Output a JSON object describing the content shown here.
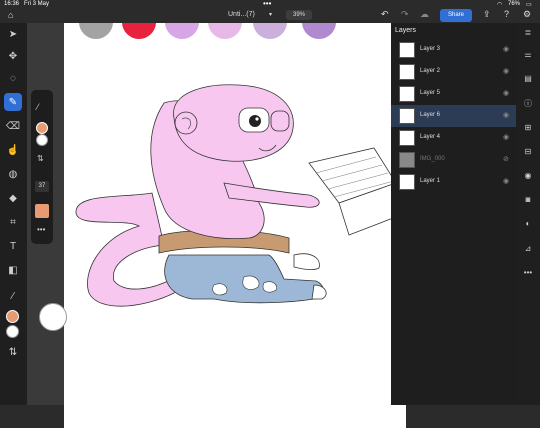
{
  "status": {
    "time": "16:36",
    "date": "Fri 3 May",
    "battery": "76%"
  },
  "document": {
    "title": "Unti...(7)",
    "zoom": "39%"
  },
  "header": {
    "share_label": "Share"
  },
  "layers": {
    "title": "Layers",
    "items": [
      {
        "name": "Layer 3",
        "visible": true
      },
      {
        "name": "Layer 2",
        "visible": true
      },
      {
        "name": "Layer 5",
        "visible": true
      },
      {
        "name": "Layer 6",
        "visible": true,
        "selected": true
      },
      {
        "name": "Layer 4",
        "visible": true
      },
      {
        "name": "IMG_000",
        "visible": false
      },
      {
        "name": "Layer 1",
        "visible": true
      }
    ]
  },
  "brush": {
    "size": "37"
  },
  "colors": {
    "primary": "#e89a72",
    "secondary": "#ffffff",
    "accent": "#2f6fd6",
    "palette": [
      "#a3a3a3",
      "#e8213f",
      "#d7a6e6",
      "#e7b9e8",
      "#cbb0de",
      "#b089cf"
    ]
  }
}
